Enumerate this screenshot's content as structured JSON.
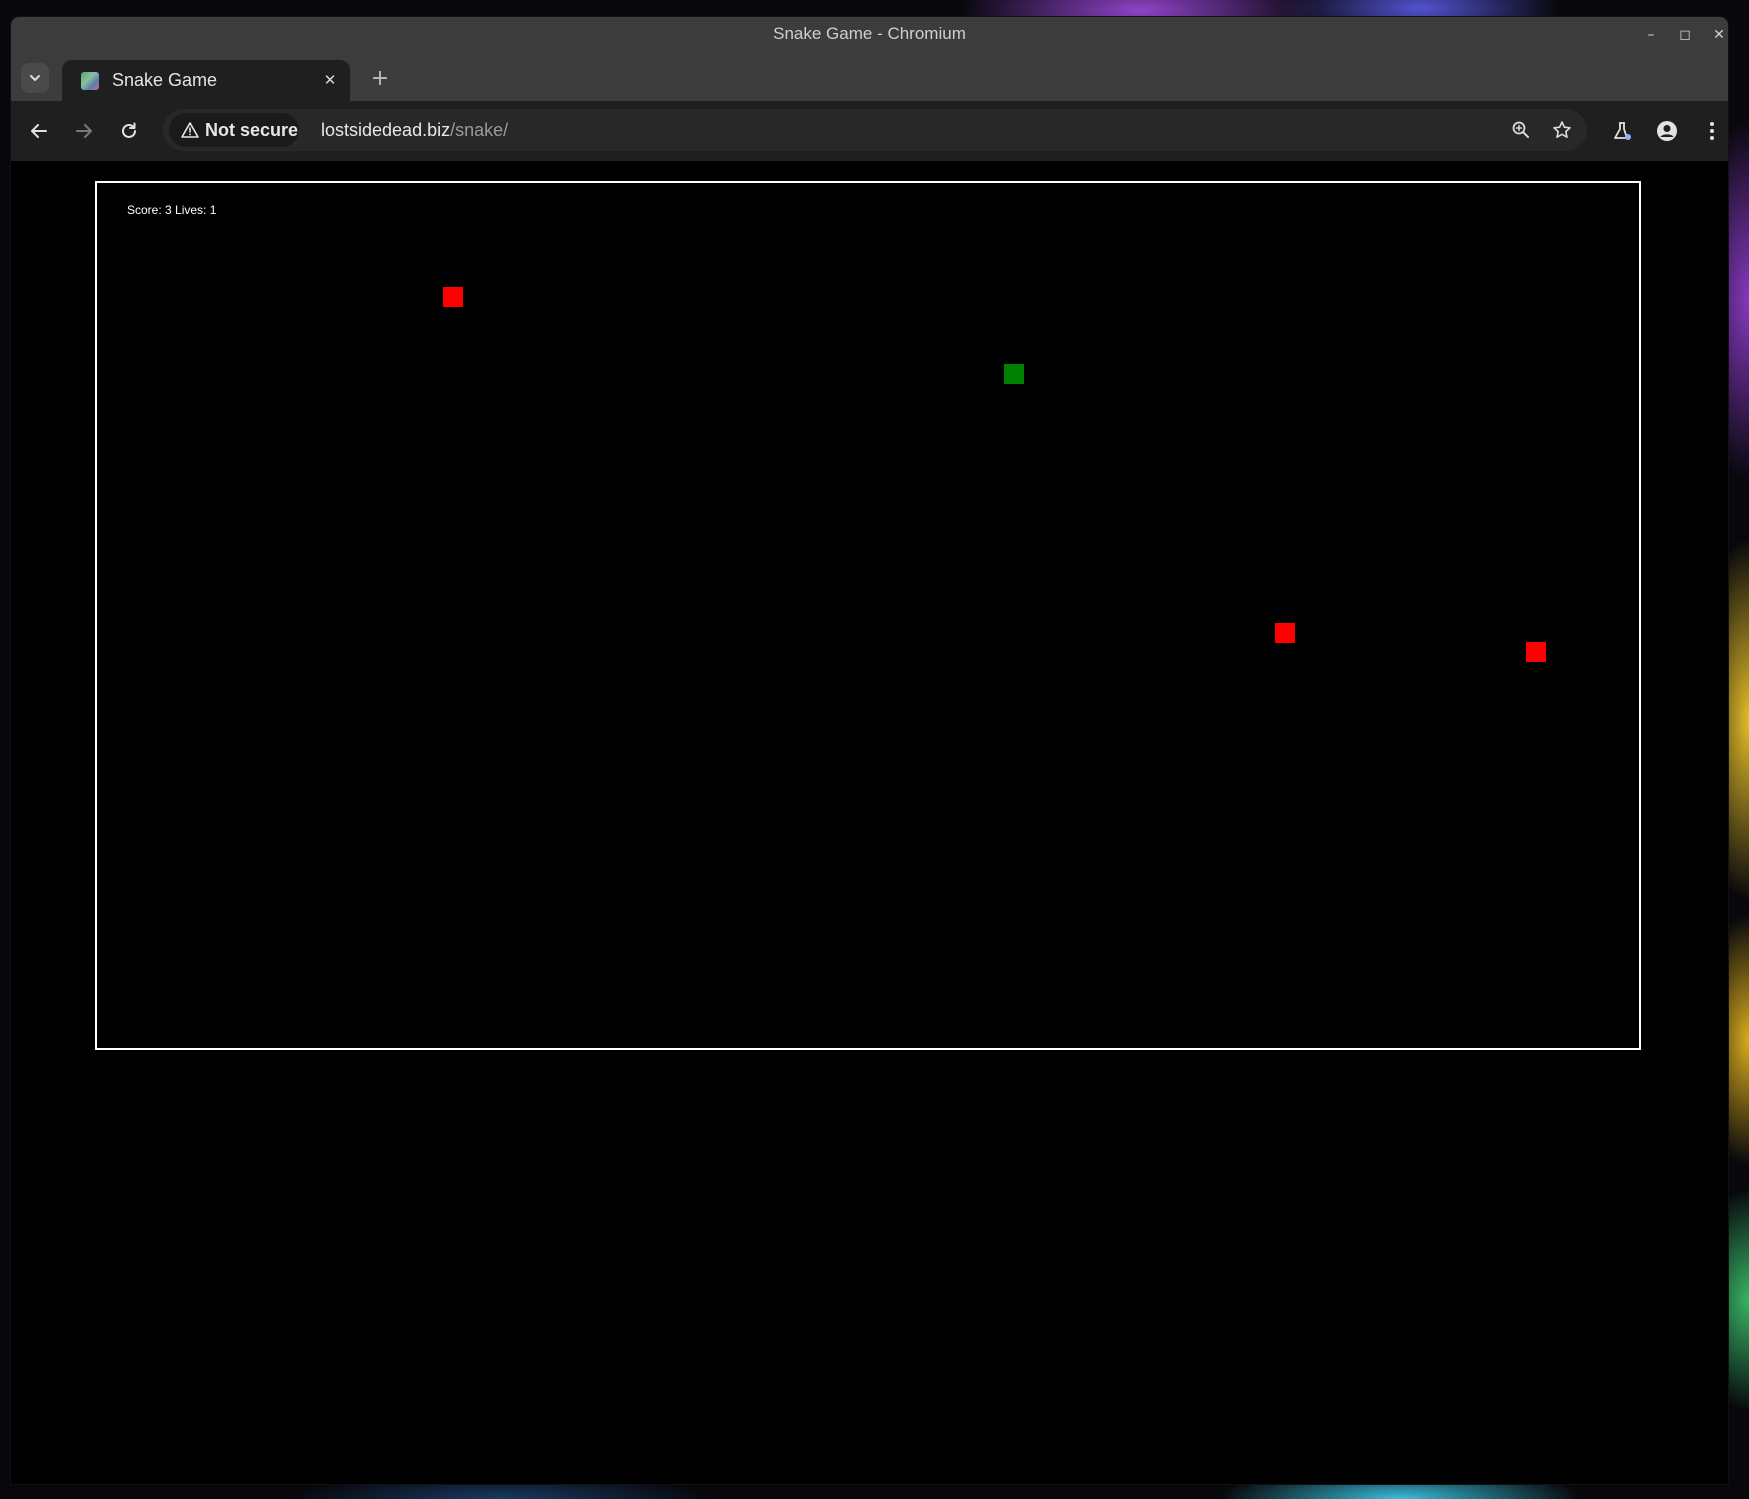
{
  "window": {
    "title": "Snake Game - Chromium",
    "controls": [
      "–",
      "◻",
      "✕"
    ]
  },
  "tabs": [
    {
      "title": "Snake Game",
      "close": "✕"
    }
  ],
  "new_tab_label": "+",
  "toolbar": {
    "security_label": "Not secure",
    "url_host": "lostsidedead.biz",
    "url_path": "/snake/"
  },
  "game": {
    "hud_text": "Score: 3 Lives: 1",
    "colors": {
      "background": "#000000",
      "border": "#ffffff",
      "food": "#ff0000",
      "snake": "#008000"
    },
    "food_count": 3,
    "snake_length": 1
  }
}
